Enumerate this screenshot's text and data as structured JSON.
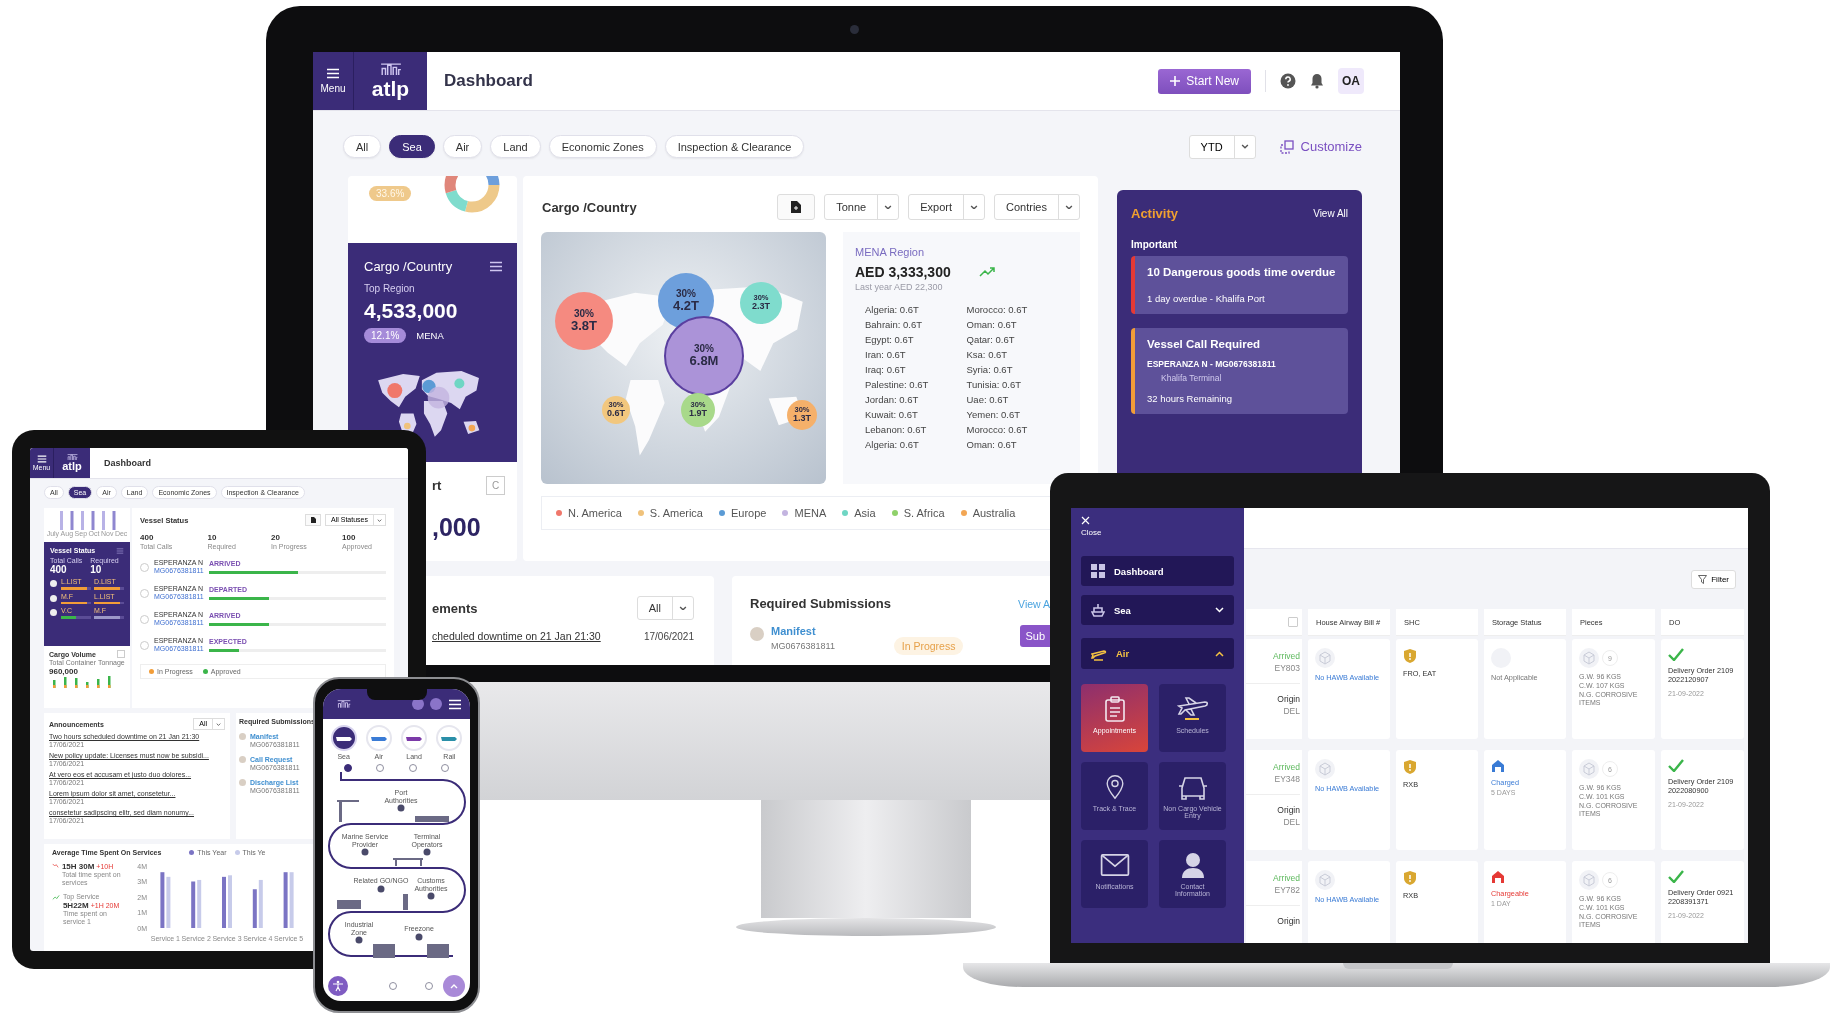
{
  "monitor": {
    "header": {
      "menu_label": "Menu",
      "logo": "atlp",
      "title": "Dashboard",
      "start_button": "Start New",
      "avatar": "OA"
    },
    "filters": [
      {
        "label": "All",
        "selected": false
      },
      {
        "label": "Sea",
        "selected": true
      },
      {
        "label": "Air",
        "selected": false
      },
      {
        "label": "Land",
        "selected": false
      },
      {
        "label": "Economic Zones",
        "selected": false
      },
      {
        "label": "Inspection & Clearance",
        "selected": false
      }
    ],
    "period": "YTD",
    "customize": "Customize",
    "summary_card": {
      "badge": "33.6%",
      "title": "Cargo /Country",
      "subtitle": "Top Region",
      "value": "4,533,000",
      "change": "12.1%",
      "region": "MENA",
      "next_title": "rt",
      "next_button": "C",
      "next_value": ",000"
    },
    "cargo": {
      "title": "Cargo /Country",
      "controls": [
        "Tonne",
        "Export",
        "Contries"
      ],
      "bubbles": [
        {
          "pct": "30%",
          "value": "3.8T",
          "color": "#f58a80"
        },
        {
          "pct": "30%",
          "value": "4.2T",
          "color": "#6d9fdc"
        },
        {
          "pct": "30%",
          "value": "2.3T",
          "color": "#7fdccd"
        },
        {
          "pct": "30%",
          "value": "6.8M",
          "color": "#ab93d8"
        },
        {
          "pct": "30%",
          "value": "0.6T",
          "color": "#f2c77e"
        },
        {
          "pct": "30%",
          "value": "1.9T",
          "color": "#a8d98a"
        },
        {
          "pct": "30%",
          "value": "1.3T",
          "color": "#f5b06a"
        }
      ],
      "region": {
        "name": "MENA Region",
        "amount": "AED 3,333,300",
        "last_year": "Last year AED 22,300",
        "countries": [
          "Algeria: 0.6T",
          "Morocco: 0.6T",
          "Bahrain: 0.6T",
          "Oman: 0.6T",
          "Egypt: 0.6T",
          "Qatar: 0.6T",
          "Iran: 0.6T",
          "Ksa: 0.6T",
          "Iraq: 0.6T",
          "Syria: 0.6T",
          "Palestine: 0.6T",
          "Tunisia: 0.6T",
          "Jordan: 0.6T",
          "Uae: 0.6T",
          "Kuwait: 0.6T",
          "Yemen: 0.6T",
          "Lebanon: 0.6T",
          "Morocco: 0.6T",
          "Algeria: 0.6T",
          "Oman: 0.6T"
        ]
      },
      "legend": [
        {
          "label": "N. America",
          "color": "#f0776b"
        },
        {
          "label": "S. America",
          "color": "#f0c27b"
        },
        {
          "label": "Europe",
          "color": "#5b9bd5"
        },
        {
          "label": "MENA",
          "color": "#c3b4e0"
        },
        {
          "label": "Asia",
          "color": "#6fd6c4"
        },
        {
          "label": "S. Africa",
          "color": "#8fd16a"
        },
        {
          "label": "Australia",
          "color": "#f2a654"
        }
      ]
    },
    "activity": {
      "title": "Activity",
      "view_all": "View All",
      "section": "Important",
      "items": [
        {
          "kind": "alert",
          "color": "#e53935",
          "title": "10 Dangerous goods time overdue",
          "detail": "1 day overdue - Khalifa Port"
        },
        {
          "kind": "vessel",
          "color": "#f29d38",
          "title": "Vessel Call Required",
          "vessel": "ESPERANZA N - MG0676381811",
          "terminal": "Khalifa Terminal",
          "detail": "32 hours Remaining"
        }
      ]
    },
    "announcements": {
      "title": "ements",
      "filter": "All",
      "items": [
        {
          "text": "cheduled downtime on 21 Jan 21:30",
          "date": "17/06/2021"
        }
      ]
    },
    "submissions": {
      "title": "Required Submissions",
      "view_all": "View A",
      "items": [
        {
          "name": "Manifest",
          "id": "MG0676381811",
          "status": "In Progress",
          "action": "Sub"
        }
      ]
    }
  },
  "tablet": {
    "header": {
      "menu_label": "Menu",
      "logo": "atlp",
      "title": "Dashboard"
    },
    "filters": [
      {
        "label": "All",
        "selected": false
      },
      {
        "label": "Sea",
        "selected": true
      },
      {
        "label": "Air",
        "selected": false
      },
      {
        "label": "Land",
        "selected": false
      },
      {
        "label": "Economic Zones",
        "selected": false
      },
      {
        "label": "Inspection & Clearance",
        "selected": false
      }
    ],
    "months": [
      "July",
      "Aug",
      "Sep",
      "Oct",
      "Nov",
      "Dec"
    ],
    "vessel_summary": {
      "title": "Vessel Status",
      "stats": [
        {
          "label": "Total Calls",
          "value": "400"
        },
        {
          "label": "Required",
          "value": "10"
        }
      ],
      "bars": [
        {
          "label": "L.LIST",
          "level": 0.85,
          "color": "#f29d38"
        },
        {
          "label": "D.LIST",
          "level": 0.85,
          "color": "#f29d38"
        },
        {
          "label": "M.F",
          "level": 0.85,
          "color": "#f29d38"
        },
        {
          "label": "L.LIST",
          "level": 0.85,
          "color": "#f29d38"
        },
        {
          "label": "V.C",
          "level": 0.5,
          "color": "#3bb54a"
        },
        {
          "label": "M.F",
          "level": 0.85,
          "color": "#9c98c8"
        }
      ]
    },
    "cargo_volume": {
      "title": "Cargo Volume",
      "subtitle": "Total Container Tonnage",
      "value": "960,000"
    },
    "vessel_status": {
      "title": "Vessel Status",
      "filter": "All Statuses",
      "stats": [
        {
          "value": "400",
          "label": "Total Calls"
        },
        {
          "value": "10",
          "label": "Required"
        },
        {
          "value": "20",
          "label": "In Progress"
        },
        {
          "value": "100",
          "label": "Approved"
        }
      ],
      "rows": [
        {
          "vessel": "ESPERANZA N",
          "id": "MG0676381811",
          "status": "ARRIVED",
          "level": 0.5,
          "selected": false
        },
        {
          "vessel": "ESPERANZA N",
          "id": "MG0676381811",
          "status": "DEPARTED",
          "level": 0.34,
          "selected": false
        },
        {
          "vessel": "ESPERANZA N",
          "id": "MG0676381811",
          "status": "ARRIVED",
          "level": 0.34,
          "selected": false
        },
        {
          "vessel": "ESPERANZA N",
          "id": "MG0676381811",
          "status": "EXPECTED",
          "level": 0.17,
          "selected": false
        }
      ],
      "legend": [
        {
          "label": "In Progress",
          "color": "#f29d38"
        },
        {
          "label": "Approved",
          "color": "#3bb54a"
        }
      ]
    },
    "announcements": {
      "title": "Announcements",
      "filter": "All",
      "items": [
        {
          "text": "Two hours scheduled downtime on 21 Jan 21:30",
          "date": "17/06/2021"
        },
        {
          "text": "New policy update: Licenses must now be subsidi...",
          "date": "17/06/2021"
        },
        {
          "text": "At vero eos et accusam et justo duo dolores...",
          "date": "17/06/2021"
        },
        {
          "text": "Lorem ipsum dolor sit amet, consetetur...",
          "date": "17/06/2021"
        },
        {
          "text": "consetetur sadipscing elitr, sed diam nonumy...",
          "date": "17/06/2021"
        }
      ]
    },
    "submissions": {
      "title": "Required Submissions",
      "items": [
        {
          "name": "Manifest",
          "id": "MG0676381811"
        },
        {
          "name": "Call Request",
          "id": "MG0676381811"
        },
        {
          "name": "Discharge List",
          "id": "MG0676381811"
        }
      ]
    },
    "services": {
      "title": "Average Time Spent On Services",
      "stats": [
        {
          "value": "15H 30M",
          "change": "+10H",
          "label": "Total time spent on services"
        },
        {
          "top": "Top Service",
          "value": "5H22M",
          "change": "+1H 20M",
          "label": "Time spent on service 1"
        }
      ],
      "chart_data": {
        "type": "bar",
        "categories": [
          "Service 1",
          "Service 2",
          "Service 3",
          "Service 4",
          "Service 5"
        ],
        "series": [
          {
            "name": "This Year",
            "color": "#7b74c4",
            "values": [
              3.6,
              3.0,
              3.3,
              2.5,
              3.6
            ]
          },
          {
            "name": "This Ye",
            "color": "#c7cbea",
            "values": [
              3.3,
              3.1,
              3.4,
              3.1,
              3.6
            ]
          }
        ],
        "ylim": [
          0,
          4
        ],
        "yticks": [
          {
            "value": 0,
            "label": "0M"
          },
          {
            "value": 1,
            "label": "1M"
          },
          {
            "value": 2,
            "label": "2M"
          },
          {
            "value": 3,
            "label": "3M"
          },
          {
            "value": 4,
            "label": "4M"
          }
        ]
      }
    }
  },
  "phone": {
    "modes": [
      {
        "label": "Sea",
        "selected": true
      },
      {
        "label": "Air",
        "selected": false
      },
      {
        "label": "Land",
        "selected": false
      },
      {
        "label": "Rail",
        "selected": false
      }
    ],
    "stops": [
      "Port Authorities",
      "Marine Service Provider",
      "Terminal Operators",
      "Related GO/NGO",
      "Customs Authorities",
      "Industrial Zone",
      "Freezone"
    ],
    "page_dots": [
      {
        "selected": false
      },
      {
        "selected": false
      }
    ]
  },
  "laptop": {
    "close": "Close",
    "nav": [
      {
        "label": "Dashboard",
        "kind": "link",
        "selected": false
      },
      {
        "label": "Sea",
        "kind": "group",
        "expanded": false,
        "selected": false
      },
      {
        "label": "Air",
        "kind": "group",
        "expanded": true,
        "selected": true
      }
    ],
    "tiles": [
      {
        "label": "Appointments",
        "selected": true
      },
      {
        "label": "Schedules",
        "selected": false
      },
      {
        "label": "Track & Trace",
        "selected": false
      },
      {
        "label": "Non Cargo Vehicle Entry",
        "selected": false
      },
      {
        "label": "Notifications",
        "selected": false
      },
      {
        "label": "Contact Information",
        "selected": false
      }
    ],
    "filter": "Filter",
    "select_all": {
      "checked": false
    },
    "columns": [
      "House Airway Bill #",
      "SHC",
      "Storage Status",
      "Pieces",
      "DO"
    ],
    "rows": [
      {
        "status": "Arrived",
        "flight": "EY803",
        "origin_label": "Origin",
        "origin": "DEL",
        "hawb": "No HAWB Available",
        "shc": "FRO, EAT",
        "storage": {
          "kind": "none",
          "label": "Not Applicable"
        },
        "pieces": "9",
        "gw": "G.W. 96 KGS",
        "cw": "C.W. 107 KGS",
        "ng": "N.G. CORROSIVE ITEMS",
        "do": "Delivery Order 2109 2022120907",
        "date": "21-09-2022"
      },
      {
        "status": "Arrived",
        "flight": "EY348",
        "origin_label": "Origin",
        "origin": "DEL",
        "hawb": "No HAWB Available",
        "shc": "RXB",
        "storage": {
          "kind": "charged",
          "label": "Charged",
          "note": "5 DAYS"
        },
        "pieces": "6",
        "gw": "G.W. 96 KGS",
        "cw": "C.W. 101 KGS",
        "ng": "N.G. CORROSIVE ITEMS",
        "do": "Delivery Order 2109 2022080900",
        "date": "21-09-2022"
      },
      {
        "status": "Arrived",
        "flight": "EY782",
        "origin_label": "Origin",
        "hawb": "No HAWB Available",
        "shc": "RXB",
        "storage": {
          "kind": "chargeable",
          "label": "Chargeable",
          "note": "1 DAY"
        },
        "pieces": "6",
        "gw": "G.W. 96 KGS",
        "cw": "C.W. 101 KGS",
        "ng": "N.G. CORROSIVE ITEMS",
        "do": "Delivery Order 0921 2208391371",
        "date": "21-09-2022"
      }
    ]
  }
}
